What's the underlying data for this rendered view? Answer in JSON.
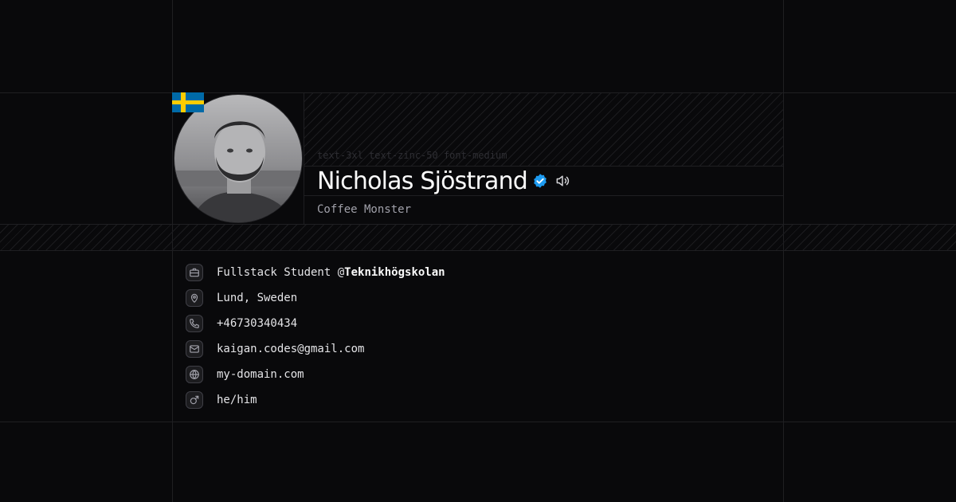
{
  "profile": {
    "name": "Nicholas Sjöstrand",
    "code_hint": "text-3xl text-zinc-50 font-medium",
    "tagline": "Coffee Monster",
    "flag": "sweden-flag",
    "verified_icon": "verified-badge-icon",
    "pronounce_icon": "speaker-icon",
    "accent_color": "#1d9bf0"
  },
  "info": {
    "job_prefix": "Fullstack Student @",
    "job_company": "Teknikhögskolan",
    "location": "Lund, Sweden",
    "phone": "+46730340434",
    "email": "kaigan.codes@gmail.com",
    "website": "my-domain.com",
    "pronouns": "he/him"
  },
  "icons": [
    "briefcase-icon",
    "map-pin-icon",
    "phone-icon",
    "mail-icon",
    "globe-icon",
    "mars-icon"
  ]
}
